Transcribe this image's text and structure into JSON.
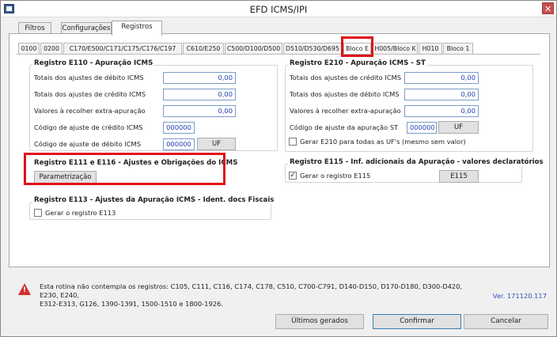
{
  "window": {
    "title": "EFD ICMS/IPI"
  },
  "tabs": [
    "Filtros",
    "Configurações",
    "Registros"
  ],
  "subtabs": [
    "0100",
    "0200",
    "C170/E500/C171/C175/C176/C197",
    "C610/E250",
    "C500/D100/D500",
    "D510/D530/D695",
    "Bloco E",
    "H005/Bloco K",
    "H010",
    "Bloco 1"
  ],
  "e110": {
    "title": "Registro E110  - Apuração ICMS",
    "rows": [
      {
        "label": "Totais dos ajustes de débito ICMS",
        "value": "0,00"
      },
      {
        "label": "Totais dos ajustes de crédito ICMS",
        "value": "0,00"
      },
      {
        "label": "Valores à recolher extra-apuração",
        "value": "0,00"
      }
    ],
    "credit_code_label": "Código de ajuste de crédito ICMS",
    "credit_code": "000000",
    "debit_code_label": "Código de ajuste de débito ICMS",
    "debit_code": "000000",
    "uf_button": "UF"
  },
  "e210": {
    "title": "Registro E210  - Apuração ICMS - ST",
    "rows": [
      {
        "label": "Totais dos ajustes de crédito ICMS",
        "value": "0,00"
      },
      {
        "label": "Totais dos ajustes de débito ICMS",
        "value": "0,00"
      },
      {
        "label": "Valores à recolher extra-apuração",
        "value": "0,00"
      }
    ],
    "code_label": "Código de ajuste da apuração ST",
    "code": "000000",
    "uf_button": "UF",
    "checkbox_label": "Gerar E210 para todas as UF's (mesmo sem valor)",
    "checkbox_checked": false
  },
  "e111": {
    "title": "Registro E111 e E116 - Ajustes e Obrigações do ICMS",
    "button": "Parametrização"
  },
  "e115": {
    "title": "Registro E115 - Inf. adicionais da Apuração - valores declaratórios",
    "checkbox_label": "Gerar o registro E115",
    "checkbox_checked": true,
    "button": "E115"
  },
  "e113": {
    "title": "Registro E113 - Ajustes da Apuração ICMS - Ident. docs Fiscais",
    "checkbox_label": "Gerar o registro E113",
    "checkbox_checked": false
  },
  "footer": {
    "notice_line1": "Esta rotina não contempla os registros: C105, C111, C116, C174, C178, C510, C700-C791, D140-D150, D170-D180, D300-D420, E230, E240,",
    "notice_line2": "E312-E313, G126, 1390-1391, 1500-1510 e 1800-1926.",
    "version": "Ver. 171120.117",
    "buttons": {
      "last": "Últimos gerados",
      "confirm": "Confirmar",
      "cancel": "Cancelar"
    }
  }
}
